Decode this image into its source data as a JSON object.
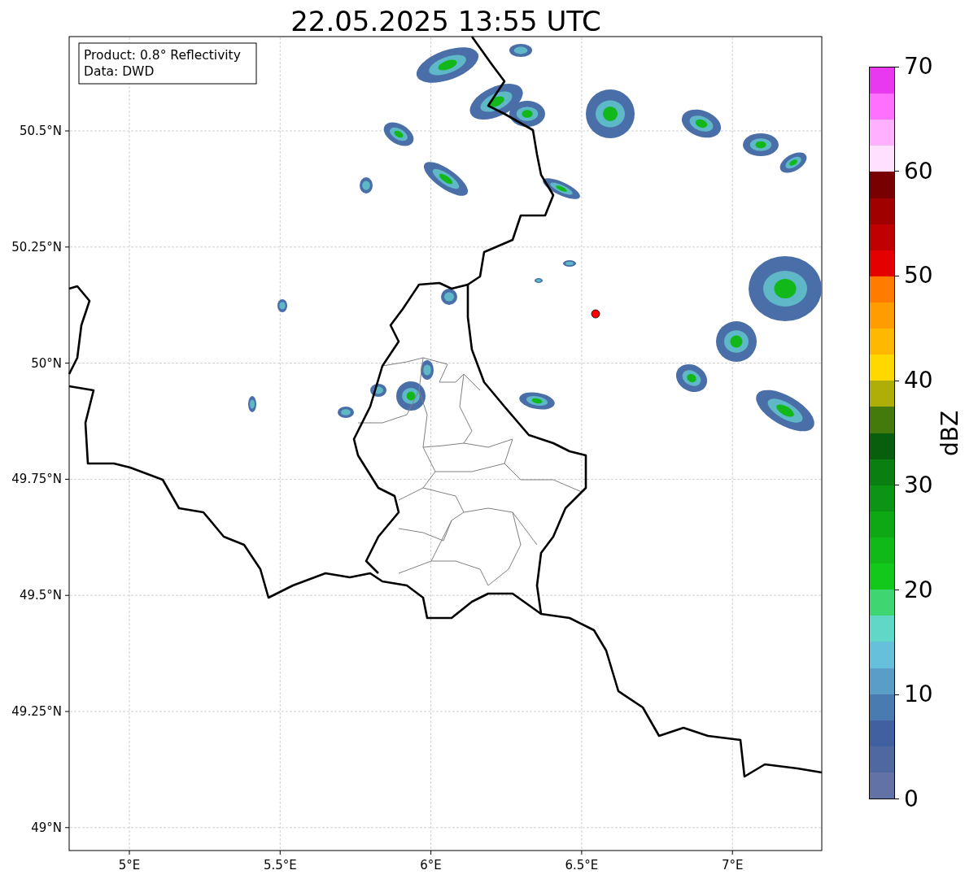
{
  "title": "22.05.2025 13:55 UTC",
  "info_box": [
    "Product: 0.8° Reflectivity",
    "Data: DWD"
  ],
  "map": {
    "y_ticks": [
      "50.5°N",
      "50.25°N",
      "50°N",
      "49.75°N",
      "49.5°N",
      "49.25°N",
      "49°N"
    ],
    "x_ticks": [
      "5°E",
      "5.5°E",
      "6°E",
      "6.5°E",
      "7°E"
    ]
  },
  "colorbar": {
    "label": "dBZ",
    "ticks": [
      "70",
      "60",
      "50",
      "40",
      "30",
      "20",
      "10",
      "0"
    ],
    "bins": [
      {
        "color": "#e838f0"
      },
      {
        "color": "#ff70ff"
      },
      {
        "color": "#ffb0ff"
      },
      {
        "color": "#ffe0ff"
      },
      {
        "color": "#780000"
      },
      {
        "color": "#a00000"
      },
      {
        "color": "#c00000"
      },
      {
        "color": "#e40000"
      },
      {
        "color": "#ff7c00"
      },
      {
        "color": "#ff9c00"
      },
      {
        "color": "#ffb800"
      },
      {
        "color": "#ffd800"
      },
      {
        "color": "#aeae08"
      },
      {
        "color": "#447a0c"
      },
      {
        "color": "#085e0c"
      },
      {
        "color": "#0a7e10"
      },
      {
        "color": "#0c9414"
      },
      {
        "color": "#0ea814"
      },
      {
        "color": "#10b818"
      },
      {
        "color": "#12c81a"
      },
      {
        "color": "#3dd670"
      },
      {
        "color": "#5fd8c8"
      },
      {
        "color": "#66c0dc"
      },
      {
        "color": "#5a9ec8"
      },
      {
        "color": "#4a7bb0"
      },
      {
        "color": "#4060a0"
      },
      {
        "color": "#5068a0"
      },
      {
        "color": "#6372a6"
      }
    ]
  }
}
